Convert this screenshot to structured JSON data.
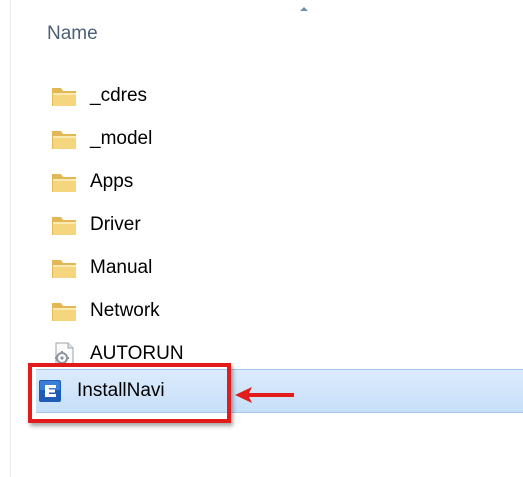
{
  "header": {
    "name_column": "Name"
  },
  "files": [
    {
      "name": "_cdres",
      "icon": "folder-icon"
    },
    {
      "name": "_model",
      "icon": "folder-icon"
    },
    {
      "name": "Apps",
      "icon": "folder-icon"
    },
    {
      "name": "Driver",
      "icon": "folder-icon"
    },
    {
      "name": "Manual",
      "icon": "folder-icon"
    },
    {
      "name": "Network",
      "icon": "folder-icon"
    },
    {
      "name": "AUTORUN",
      "icon": "setup-info-file-icon"
    },
    {
      "name": "InstallNavi",
      "icon": "installnavi-app-icon",
      "selected": true
    }
  ],
  "colors": {
    "selection": "#cce4f9",
    "callout": "#e21b1b",
    "header_text": "#4c607a"
  }
}
